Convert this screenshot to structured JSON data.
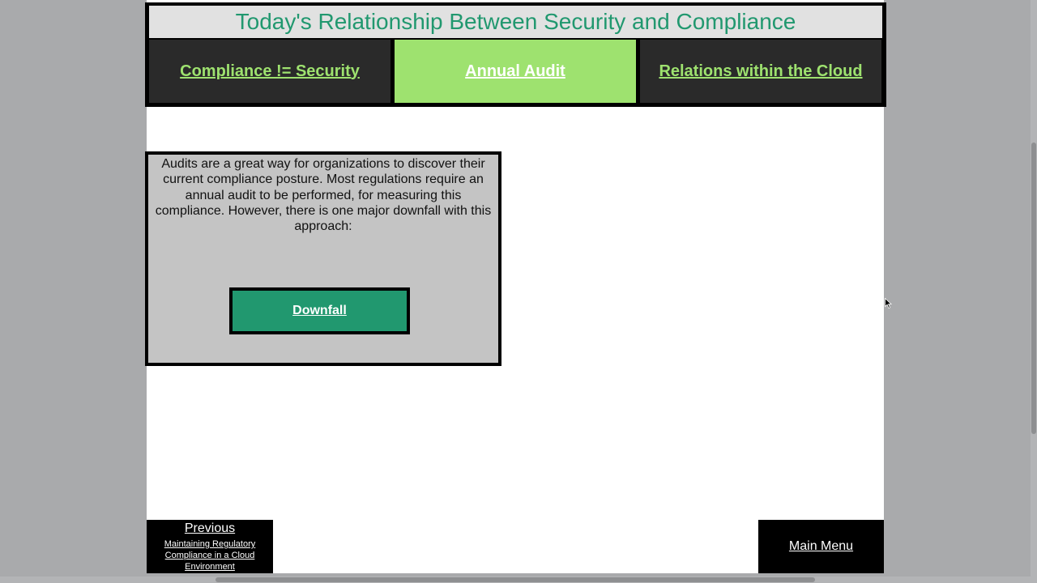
{
  "header": {
    "title": "Today's Relationship Between Security and Compliance"
  },
  "tabs": [
    {
      "label": "Compliance != Security",
      "active": false
    },
    {
      "label": "Annual Audit",
      "active": true
    },
    {
      "label": "Relations within the Cloud",
      "active": false
    }
  ],
  "content": {
    "paragraph": "Audits are a great way for organizations to discover their current compliance posture. Most regulations require an annual audit to be performed, for measuring this compliance. However, there is one major downfall with this approach:",
    "button_label": "Downfall"
  },
  "footer": {
    "previous_label": "Previous",
    "previous_sub": "Maintaining Regulatory Compliance in a Cloud Environment",
    "main_menu_label": "Main Menu"
  },
  "colors": {
    "accent_green": "#21986f",
    "light_green": "#9ee26f",
    "dark_tab": "#2a2a2a",
    "card_gray": "#c4c4c4"
  }
}
